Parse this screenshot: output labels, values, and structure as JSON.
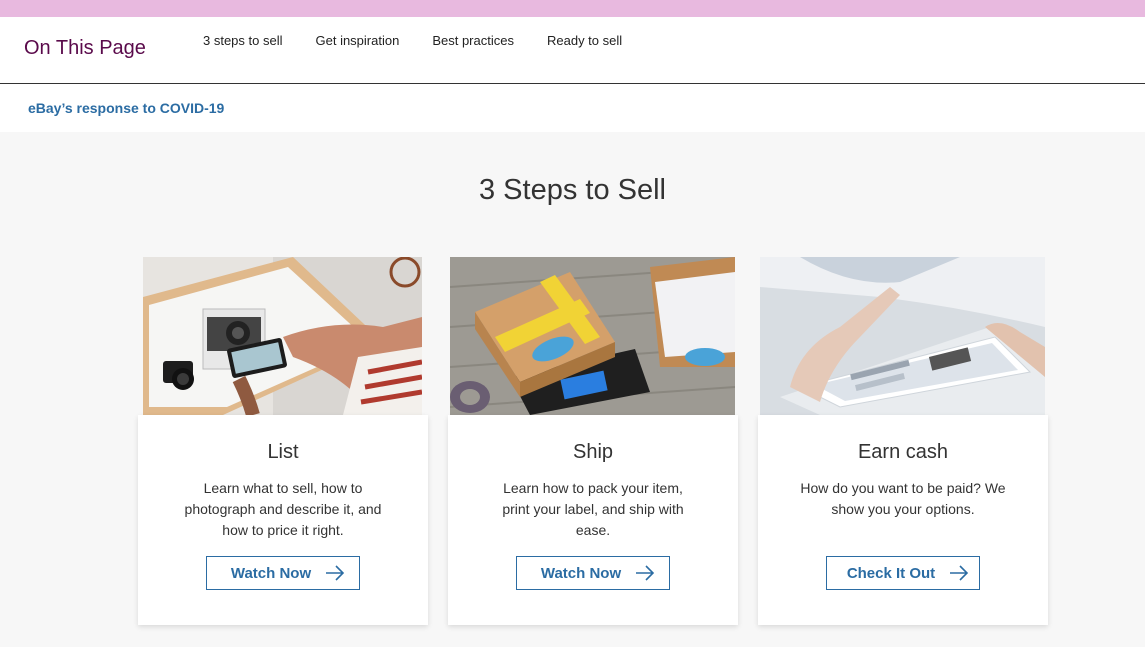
{
  "on_this_page": {
    "title": "On This Page",
    "nav": [
      "3 steps to sell",
      "Get inspiration",
      "Best practices",
      "Ready to sell"
    ]
  },
  "covid_link": "eBay’s response to COVID-19",
  "section": {
    "title": "3 Steps to Sell",
    "cards": [
      {
        "title": "List",
        "description": "Learn what to sell, how to photograph and describe it, and how to price it right.",
        "button": "Watch Now",
        "image_icon": "camera-photo-image"
      },
      {
        "title": "Ship",
        "description": "Learn how to pack your item, print your label, and ship with ease.",
        "button": "Watch Now",
        "image_icon": "package-scale-image"
      },
      {
        "title": "Earn cash",
        "description": "How do you want to be paid? We show you your options.",
        "button": "Check It Out",
        "image_icon": "tablet-payment-image"
      }
    ]
  },
  "colors": {
    "accent": "#2b6ca3",
    "title_purple": "#5a0a4b",
    "top_bar": "#e8b9df"
  }
}
